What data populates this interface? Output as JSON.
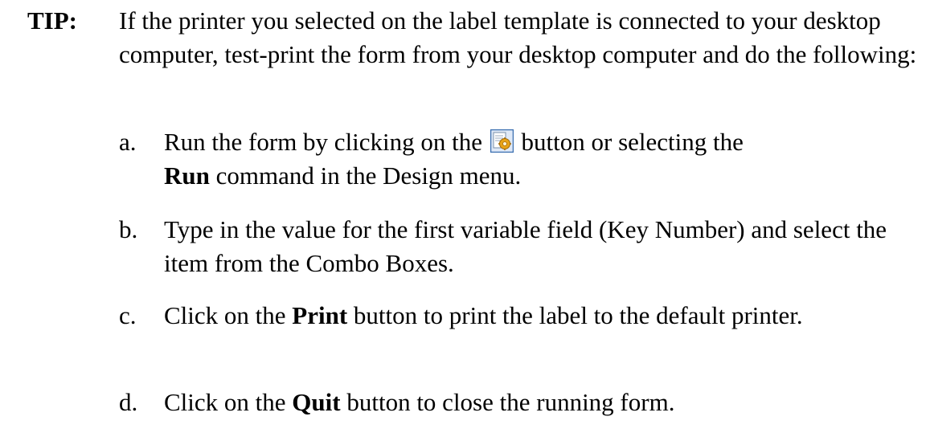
{
  "tip": {
    "label": "TIP:",
    "intro": "If the printer you selected on the label template is connected to your desktop computer, test-print the form from your desktop computer and do the following:"
  },
  "steps": {
    "a": {
      "letter": "a.",
      "text_before_icon": "Run the form by clicking on the",
      "text_after_icon": "button or selecting the",
      "bold": "Run",
      "text_after_bold": "command in the Design menu.",
      "icon": "run-form-icon"
    },
    "b": {
      "letter": "b.",
      "text": "Type in the value for the first variable field (Key Number) and select the item from the Combo Boxes."
    },
    "c": {
      "letter": "c.",
      "text_before_bold": "Click on the",
      "bold": "Print",
      "text_after_bold": "button to print the label to the default printer."
    },
    "d": {
      "letter": "d.",
      "text_before_bold": "Click on the",
      "bold": "Quit",
      "text_after_bold": "button to close the running form."
    }
  },
  "colors": {
    "text": "#000000",
    "icon_border": "#3a6fb0",
    "icon_fill": "#dfe9f7",
    "icon_gear": "#e8a317"
  }
}
